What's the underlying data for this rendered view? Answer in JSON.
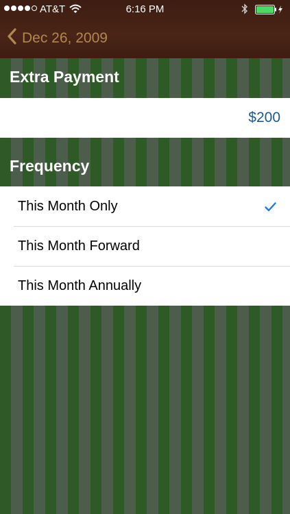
{
  "status_bar": {
    "carrier": "AT&T",
    "time": "6:16 PM",
    "signal_bars_filled": 4,
    "signal_bars_total": 5,
    "battery_color": "#4cd964"
  },
  "nav": {
    "back_label": "Dec 26, 2009",
    "back_color": "#b08850"
  },
  "extra_payment": {
    "header": "Extra Payment",
    "value": "$200"
  },
  "frequency": {
    "header": "Frequency",
    "options": [
      {
        "label": "This Month Only",
        "selected": true
      },
      {
        "label": "This Month Forward",
        "selected": false
      },
      {
        "label": "This Month Annually",
        "selected": false
      }
    ],
    "check_color": "#1a7be0"
  }
}
